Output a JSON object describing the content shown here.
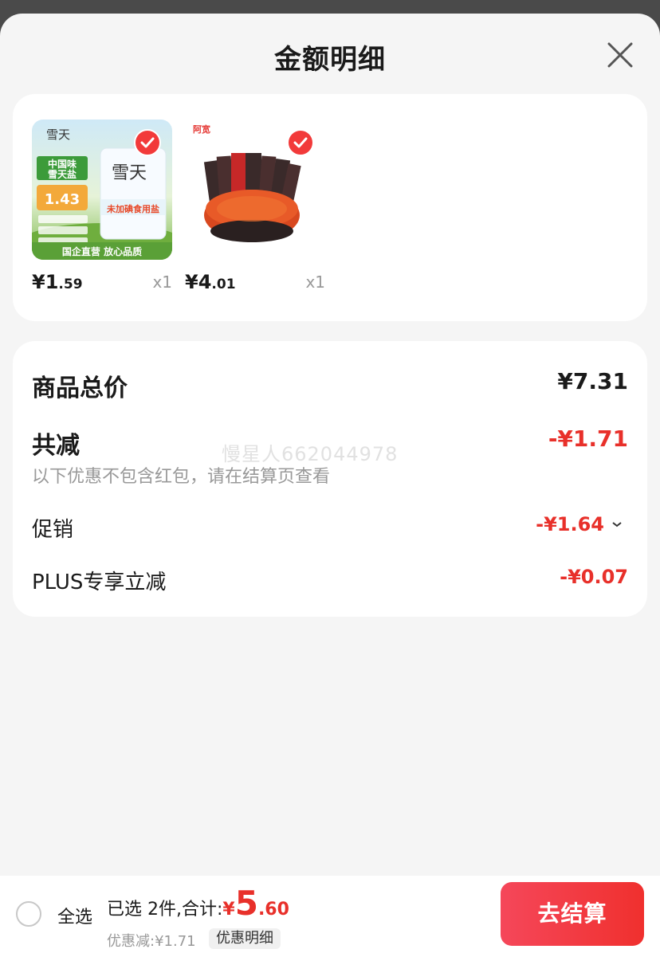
{
  "sheet": {
    "title": "金额明细"
  },
  "products": [
    {
      "name": "雪天未加碘食用盐",
      "price_int": "1",
      "price_dec": ".59",
      "qty": "x1",
      "badge_text": "1.43",
      "brand": "雪天",
      "promo_top": "中国味",
      "promo_top2": "雪天盐",
      "bag_label": "未加碘食用盐",
      "banner": "国企直营  放心品质"
    },
    {
      "name": "阿宽 面",
      "price_int": "4",
      "price_dec": ".01",
      "qty": "x1",
      "brand": "阿宽"
    }
  ],
  "currency": "¥",
  "summary": {
    "total_label": "商品总价",
    "total_value": "¥7.31",
    "reduce_label": "共减",
    "reduce_value": "-¥1.71",
    "note": "以下优惠不包含红包，请在结算页查看",
    "promo_label": "促销",
    "promo_value": "-¥1.64",
    "plus_label": "PLUS专享立减",
    "plus_value": "-¥0.07",
    "watermark": "慢星人662044978"
  },
  "footer": {
    "select_all": "全选",
    "selected_text": "已选 2件,合计:",
    "total_yen": "¥",
    "total_int": "5",
    "total_dec": ".60",
    "discount_text": "优惠减:¥1.71",
    "detail_chip": "优惠明细",
    "checkout": "去结算"
  },
  "colors": {
    "accent": "#e8302a",
    "button": "#f0302e"
  }
}
